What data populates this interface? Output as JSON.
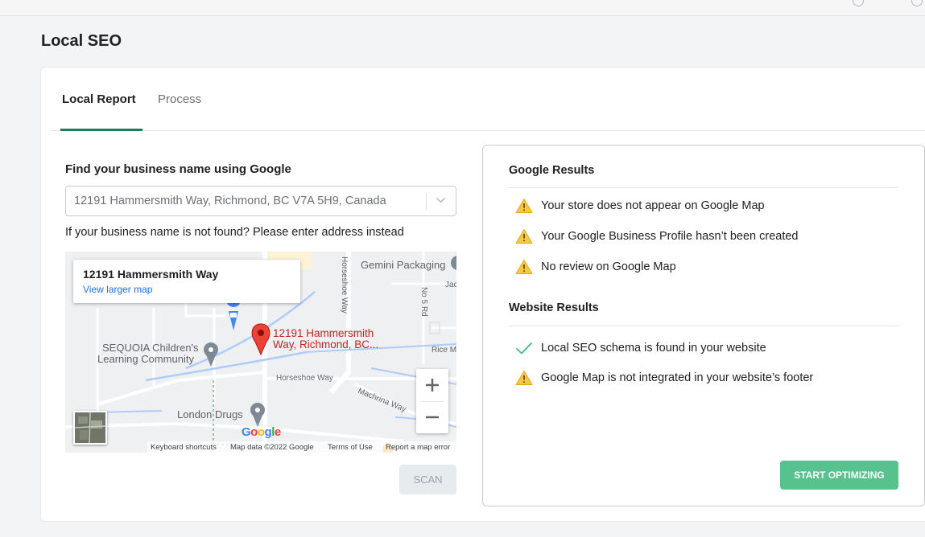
{
  "page": {
    "title": "Local SEO"
  },
  "tabs": [
    {
      "label": "Local Report",
      "active": true
    },
    {
      "label": "Process",
      "active": false
    }
  ],
  "search": {
    "label": "Find your business name using Google",
    "value": "12191 Hammersmith Way, Richmond, BC V7A 5H9, Canada",
    "hint": "If your business name is not found? Please enter address instead"
  },
  "map": {
    "card_title": "12191 Hammersmith Way",
    "card_link": "View larger map",
    "pin_label_line1": "12191 Hammersmith",
    "pin_label_line2": "Way, Richmond, BC...",
    "poi": {
      "gemini": "Gemini Packaging",
      "sequoia_line1": "SEQUOIA Children's",
      "sequoia_line2": "Learning Community",
      "london": "London Drugs"
    },
    "streets": {
      "horseshoe_way_v": "Horseshoe Way",
      "horseshoe_way_h": "Horseshoe Way",
      "no5rd": "No 5 Rd",
      "machrina": "Machrina Way",
      "rice": "Rice Mi",
      "jac": "Jac"
    },
    "google_logo": "Google",
    "attribution": {
      "shortcuts": "Keyboard shortcuts",
      "data": "Map data ©2022 Google",
      "terms": "Terms of Use",
      "report": "Report a map error"
    }
  },
  "scan_button": "SCAN",
  "google_results": {
    "title": "Google Results",
    "items": [
      {
        "icon": "warning-icon",
        "text": "Your store does not appear on Google Map"
      },
      {
        "icon": "warning-icon",
        "text": "Your Google Business Profile hasn’t been created"
      },
      {
        "icon": "warning-icon",
        "text": "No review on Google Map"
      }
    ]
  },
  "website_results": {
    "title": "Website Results",
    "items": [
      {
        "icon": "check-icon",
        "text": "Local SEO schema is found in your website"
      },
      {
        "icon": "warning-icon",
        "text": "Google Map is not integrated in your website’s footer"
      }
    ]
  },
  "start_button": "START OPTIMIZING",
  "colors": {
    "accent": "#1f7a5c",
    "warning": "#f6c744",
    "success": "#3fbf7f",
    "start_button": "#58c28e",
    "pin": "#ea4335"
  }
}
